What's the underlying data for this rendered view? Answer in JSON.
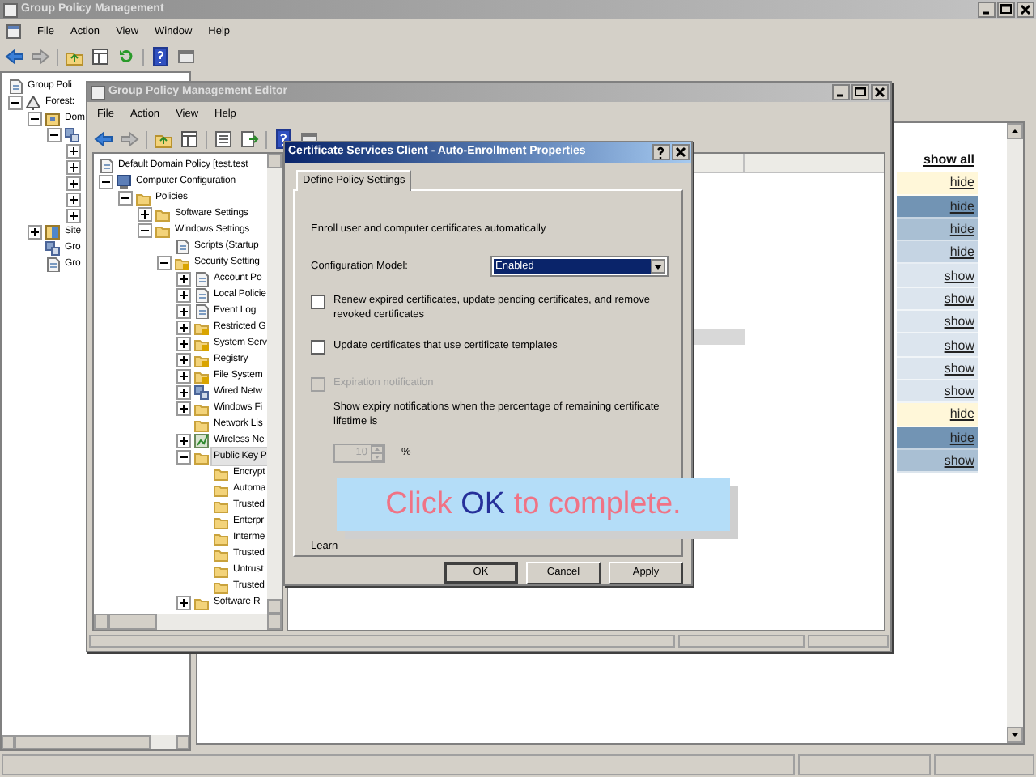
{
  "main_window": {
    "title": "Group Policy Management",
    "menu": [
      "File",
      "Action",
      "View",
      "Window",
      "Help"
    ],
    "tree": [
      {
        "label": "Group Poli",
        "kind": "document",
        "children": [
          {
            "label": "Forest:",
            "kind": "forest",
            "expanded": true,
            "children": [
              {
                "label": "Dom",
                "kind": "domain",
                "expanded": true,
                "children": [
                  {
                    "kind": "network",
                    "expanded": true,
                    "children": [
                      {
                        "expanded": false
                      },
                      {
                        "expanded": false
                      },
                      {
                        "expanded": false
                      },
                      {
                        "expanded": false
                      },
                      {
                        "expanded": false
                      }
                    ]
                  }
                ]
              },
              {
                "label": "Site",
                "kind": "site",
                "expanded": false
              },
              {
                "label": "Gro",
                "kind": "network"
              },
              {
                "label": "Gro",
                "kind": "document"
              }
            ]
          }
        ]
      }
    ],
    "links": [
      {
        "label": "show all",
        "color": "#ffffff"
      },
      {
        "label": "hide",
        "color": "#fff7d9"
      },
      {
        "label": "hide",
        "color": "#7294b4"
      },
      {
        "label": "hide",
        "color": "#a9bfd3"
      },
      {
        "label": "hide",
        "color": "#c5d4e3"
      },
      {
        "label": "show",
        "color": "#dce5ee"
      },
      {
        "label": "show",
        "color": "#dce5ee"
      },
      {
        "label": "show",
        "color": "#dce5ee"
      },
      {
        "label": "show",
        "color": "#dce5ee"
      },
      {
        "label": "show",
        "color": "#dce5ee"
      },
      {
        "label": "show",
        "color": "#dce5ee"
      },
      {
        "label": "hide",
        "color": "#fff7d9"
      },
      {
        "label": "hide",
        "color": "#7294b4"
      },
      {
        "label": "show",
        "color": "#a9bfd3"
      }
    ]
  },
  "editor_window": {
    "title": "Group Policy Management Editor",
    "menu": [
      "File",
      "Action",
      "View",
      "Help"
    ],
    "tree": [
      {
        "label": "Default Domain Policy [test.test",
        "kind": "document",
        "selected": false,
        "children": [
          {
            "label": "Computer Configuration",
            "kind": "computer",
            "expanded": true,
            "selected": false,
            "children": [
              {
                "label": "Policies",
                "kind": "folder",
                "expanded": true,
                "selected": false,
                "children": [
                  {
                    "label": "Software Settings",
                    "kind": "folder",
                    "expanded": false,
                    "selected": false
                  },
                  {
                    "label": "Windows Settings",
                    "kind": "folder",
                    "expanded": true,
                    "selected": false,
                    "children": [
                      {
                        "label": "Scripts (Startup",
                        "kind": "document",
                        "selected": false
                      },
                      {
                        "label": "Security Setting",
                        "kind": "locked",
                        "expanded": true,
                        "selected": false,
                        "children": [
                          {
                            "label": "Account Po",
                            "kind": "document",
                            "expanded": false,
                            "selected": false
                          },
                          {
                            "label": "Local Policie",
                            "kind": "document",
                            "expanded": false,
                            "selected": false
                          },
                          {
                            "label": "Event Log",
                            "kind": "document",
                            "expanded": false,
                            "selected": false
                          },
                          {
                            "label": "Restricted G",
                            "kind": "locked",
                            "expanded": false,
                            "selected": false
                          },
                          {
                            "label": "System Serv",
                            "kind": "locked",
                            "expanded": false,
                            "selected": false
                          },
                          {
                            "label": "Registry",
                            "kind": "locked",
                            "expanded": false,
                            "selected": false
                          },
                          {
                            "label": "File System",
                            "kind": "locked",
                            "expanded": false,
                            "selected": false
                          },
                          {
                            "label": "Wired Netw",
                            "kind": "network",
                            "expanded": false,
                            "selected": false
                          },
                          {
                            "label": "Windows Fi",
                            "kind": "folder",
                            "expanded": false,
                            "selected": false
                          },
                          {
                            "label": "Network Lis",
                            "kind": "folder",
                            "selected": false
                          },
                          {
                            "label": "Wireless Ne",
                            "kind": "wireless",
                            "expanded": false,
                            "selected": false
                          },
                          {
                            "label": "Public Key P",
                            "kind": "folder",
                            "expanded": true,
                            "selected": true,
                            "children": [
                              {
                                "label": "Encrypt",
                                "kind": "folder",
                                "selected": false
                              },
                              {
                                "label": "Automa",
                                "kind": "folder",
                                "selected": false
                              },
                              {
                                "label": "Trusted",
                                "kind": "folder",
                                "selected": false
                              },
                              {
                                "label": "Enterpr",
                                "kind": "folder",
                                "selected": false
                              },
                              {
                                "label": "Interme",
                                "kind": "folder",
                                "selected": false
                              },
                              {
                                "label": "Trusted",
                                "kind": "folder",
                                "selected": false
                              },
                              {
                                "label": "Untrust",
                                "kind": "folder",
                                "selected": false
                              },
                              {
                                "label": "Trusted",
                                "kind": "folder",
                                "selected": false
                              }
                            ]
                          },
                          {
                            "label": "Software R",
                            "kind": "folder",
                            "expanded": false,
                            "selected": false
                          }
                        ]
                      }
                    ]
                  }
                ]
              }
            ]
          }
        ]
      }
    ]
  },
  "dialog": {
    "title": "Certificate Services Client - Auto-Enrollment Properties",
    "tabs": [
      {
        "label": "Define Policy Settings",
        "selected": true
      }
    ],
    "description": "Enroll user and computer certificates automatically",
    "configuration_model": {
      "label": "Configuration Model:",
      "value": "Enabled"
    },
    "options": [
      {
        "label": "Renew expired certificates, update pending certificates, and remove revoked certificates",
        "checked": false,
        "disabled": false
      },
      {
        "label": "Update certificates that use certificate templates",
        "checked": false,
        "disabled": false
      },
      {
        "label": "Expiration notification",
        "checked": false,
        "disabled": true
      }
    ],
    "expiry_text": "Show expiry notifications when the percentage of remaining certificate lifetime is",
    "expiry_percent": {
      "value": "10",
      "unit": "%",
      "disabled": true
    },
    "learn_more": "Learn",
    "buttons": [
      {
        "label": "OK",
        "default": true
      },
      {
        "label": "Cancel",
        "default": false
      },
      {
        "label": "Apply",
        "default": false
      }
    ]
  },
  "callout": {
    "before": "Click",
    "highlight": "OK",
    "after": "to complete."
  }
}
